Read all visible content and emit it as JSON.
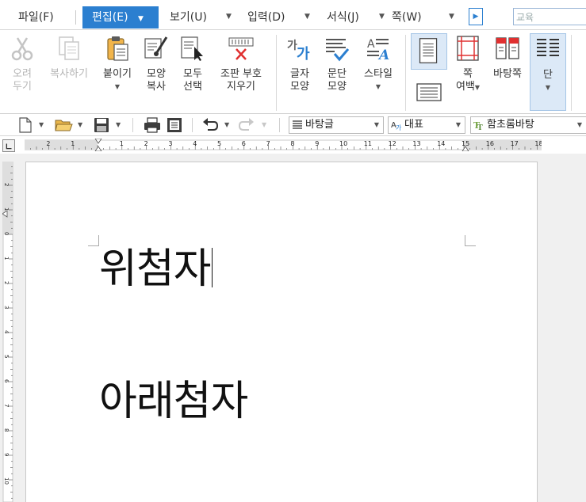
{
  "menu": {
    "items": [
      {
        "label": "파일(F)"
      },
      {
        "label": "편집(E)"
      },
      {
        "label": "보기(U)"
      },
      {
        "label": "입력(D)"
      },
      {
        "label": "서식(J)"
      },
      {
        "label": "쪽(W)"
      }
    ],
    "search_value": "교육"
  },
  "ribbon": {
    "cut": "오려\n두기",
    "copy": "복사하기",
    "paste": "붙이기",
    "format_copy": "모양\n복사",
    "select_all": "모두\n선택",
    "clear_marks": "조판 부호\n지우기",
    "char_shape": "글자\n모양",
    "para_shape": "문단\n모양",
    "style": "스타일",
    "margin": "쪽\n여백",
    "master_page": "바탕쪽",
    "columns": "단",
    "accent_color": "#2b7fd0"
  },
  "toolbar": {
    "style_combo": "바탕글",
    "font_lang": "대표",
    "font_name": "함초롬바탕"
  },
  "ruler": {
    "h_labels": [
      "2",
      "1",
      "1",
      "2",
      "3",
      "4",
      "5",
      "6",
      "7",
      "8",
      "9",
      "10",
      "11",
      "12",
      "13",
      "14",
      "15",
      "16",
      "17",
      "18"
    ],
    "v_labels": [
      "3",
      "2",
      "1",
      "0",
      "1",
      "2",
      "3",
      "4",
      "5",
      "6",
      "7",
      "8",
      "9",
      "10"
    ]
  },
  "document": {
    "line1": "위첨자",
    "line2": "아래첨자"
  }
}
